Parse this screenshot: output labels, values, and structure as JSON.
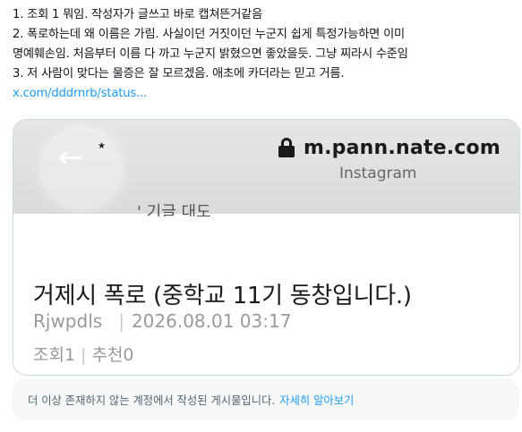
{
  "tweet": {
    "lines": [
      "1. 조회 1 뭐임. 작성자가 글쓰고 바로 캡쳐뜬거같음",
      "2. 폭로하는데 왜 이름은 가림. 사실이던 거짓이던 누군지 쉽게 특정가능하면 이미",
      "명예훼손임. 처음부터 이름 다 까고 누군지 밝혔으면 좋았을듯. 그냥 찌라시 수준임",
      "3. 저 사람이 맞다는 물증은 잘 모르겠음. 애초에 카더라는 믿고 거름."
    ],
    "link_text": "x.com/dddrnrb/status..."
  },
  "card": {
    "url": "m.pann.nate.com",
    "sub_site": "Instagram",
    "faded_header": "' 기글 대도",
    "title": "거제시 폭로 (중학교 11기 동창입니다.)",
    "author": "Rjwpdls",
    "datetime": "2026.08.01 03:17",
    "views_label": "조회1",
    "recommend_label": "추천0",
    "icons": {
      "back": "back-arrow-icon",
      "lock": "lock-icon"
    }
  },
  "notice": {
    "text": "더 이상 존재하지 않는 계정에서 작성된 게시물입니다.",
    "link": "자세히 알아보기"
  },
  "colors": {
    "link": "#1d9bf0",
    "border": "#cfd9de",
    "muted": "#536471"
  }
}
